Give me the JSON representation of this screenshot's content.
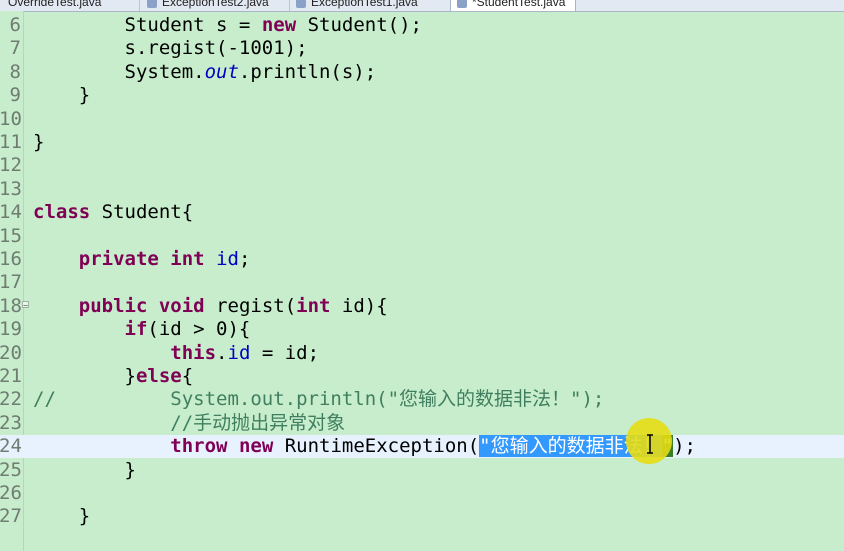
{
  "tabs": [
    {
      "label": "OverrideTest.java",
      "active": false
    },
    {
      "label": "ExceptionTest2.java",
      "active": false
    },
    {
      "label": "ExceptionTest1.java",
      "active": false
    },
    {
      "label": "*StudentTest.java",
      "active": true
    }
  ],
  "editor": {
    "current_line": 24,
    "lines": [
      {
        "n": "6",
        "parts": [
          {
            "t": "        Student "
          },
          {
            "t": "s",
            "c": "none"
          },
          {
            "t": " = "
          },
          {
            "t": "new",
            "c": "kw"
          },
          {
            "t": " Student();"
          }
        ]
      },
      {
        "n": "7",
        "parts": [
          {
            "t": "        s.regist(-1001);"
          }
        ]
      },
      {
        "n": "8",
        "parts": [
          {
            "t": "        System."
          },
          {
            "t": "out",
            "c": "st"
          },
          {
            "t": ".println(s);"
          }
        ]
      },
      {
        "n": "9",
        "parts": [
          {
            "t": "    }"
          }
        ]
      },
      {
        "n": "10",
        "parts": [
          {
            "t": ""
          }
        ]
      },
      {
        "n": "11",
        "parts": [
          {
            "t": "}"
          }
        ]
      },
      {
        "n": "12",
        "parts": [
          {
            "t": ""
          }
        ]
      },
      {
        "n": "13",
        "parts": [
          {
            "t": ""
          }
        ]
      },
      {
        "n": "14",
        "parts": [
          {
            "t": "class",
            "c": "kw"
          },
          {
            "t": " Student{"
          }
        ]
      },
      {
        "n": "15",
        "parts": [
          {
            "t": ""
          }
        ]
      },
      {
        "n": "16",
        "parts": [
          {
            "t": "    "
          },
          {
            "t": "private",
            "c": "kw"
          },
          {
            "t": " "
          },
          {
            "t": "int",
            "c": "kw"
          },
          {
            "t": " "
          },
          {
            "t": "id",
            "c": "fld"
          },
          {
            "t": ";"
          }
        ]
      },
      {
        "n": "17",
        "parts": [
          {
            "t": ""
          }
        ]
      },
      {
        "n": "18",
        "parts": [
          {
            "t": "    "
          },
          {
            "t": "public",
            "c": "kw"
          },
          {
            "t": " "
          },
          {
            "t": "void",
            "c": "kw"
          },
          {
            "t": " regist("
          },
          {
            "t": "int",
            "c": "kw"
          },
          {
            "t": " id){"
          }
        ]
      },
      {
        "n": "19",
        "parts": [
          {
            "t": "        "
          },
          {
            "t": "if",
            "c": "kw"
          },
          {
            "t": "(id > 0){"
          }
        ]
      },
      {
        "n": "20",
        "parts": [
          {
            "t": "            "
          },
          {
            "t": "this",
            "c": "kw"
          },
          {
            "t": "."
          },
          {
            "t": "id",
            "c": "fld"
          },
          {
            "t": " = id;"
          }
        ]
      },
      {
        "n": "21",
        "parts": [
          {
            "t": "        }"
          },
          {
            "t": "else",
            "c": "kw"
          },
          {
            "t": "{"
          }
        ]
      },
      {
        "n": "22",
        "parts": [
          {
            "t": "//          System.out.println(\"您输入的数据非法！\");",
            "c": "cm"
          }
        ]
      },
      {
        "n": "23",
        "parts": [
          {
            "t": "            "
          },
          {
            "t": "//手动抛出异常对象",
            "c": "cm"
          }
        ]
      },
      {
        "n": "24",
        "parts": [
          {
            "t": "            "
          },
          {
            "t": "throw",
            "c": "kw"
          },
          {
            "t": " "
          },
          {
            "t": "new",
            "c": "kw"
          },
          {
            "t": " RuntimeException("
          },
          {
            "t": "\"您输入的数据非法！",
            "c": "sel"
          },
          {
            "t": "\"",
            "c": "sel2"
          },
          {
            "t": ");"
          }
        ]
      },
      {
        "n": "25",
        "parts": [
          {
            "t": "        }"
          }
        ]
      },
      {
        "n": "26",
        "parts": [
          {
            "t": ""
          }
        ]
      },
      {
        "n": "27",
        "parts": [
          {
            "t": "    }"
          }
        ]
      }
    ]
  },
  "icons": {
    "tab_icon": "java-file-icon",
    "cursor": "text-cursor-icon",
    "fold": "fold-toggle-icon"
  }
}
